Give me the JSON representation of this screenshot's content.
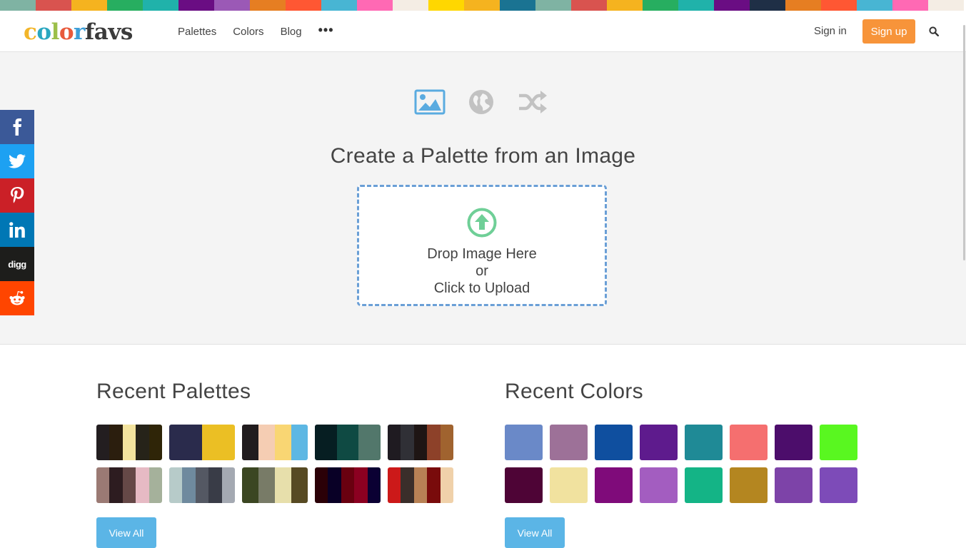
{
  "top_strip_colors": [
    "#7fb3a3",
    "#d9534f",
    "#f5b31f",
    "#27ae60",
    "#20b2aa",
    "#6a0d83",
    "#9b59b6",
    "#e67e22",
    "#ff5733",
    "#48b5d3",
    "#ff69b4",
    "#f4ede4",
    "#ffd700",
    "#f5b31f",
    "#1a7392",
    "#7fb3a3",
    "#d9534f",
    "#f5b31f",
    "#27ae60",
    "#20b2aa",
    "#6a0d83",
    "#1f2f46",
    "#e67e22",
    "#ff5733",
    "#48b5d3",
    "#ff69b4",
    "#f4ede4"
  ],
  "logo": {
    "p1": "c",
    "p2": "o",
    "p3": "l",
    "p4": "o",
    "p5": "r",
    "p6": "favs"
  },
  "nav": {
    "palettes": "Palettes",
    "colors": "Colors",
    "blog": "Blog",
    "more": "•••"
  },
  "auth": {
    "signin": "Sign in",
    "signup": "Sign up"
  },
  "hero": {
    "title": "Create a Palette from an Image",
    "drop_line1": "Drop Image Here",
    "drop_line2": "or",
    "drop_line3": "Click to Upload",
    "icons": [
      "image-icon",
      "globe-icon",
      "shuffle-icon"
    ]
  },
  "social": [
    {
      "name": "facebook",
      "label": "f",
      "color": "#3b5998"
    },
    {
      "name": "twitter",
      "label": "twitter",
      "color": "#1da1f2"
    },
    {
      "name": "pinterest",
      "label": "P",
      "color": "#cb2027"
    },
    {
      "name": "linkedin",
      "label": "in",
      "color": "#0077b5"
    },
    {
      "name": "digg",
      "label": "digg",
      "color": "#1d1d1b"
    },
    {
      "name": "reddit",
      "label": "reddit",
      "color": "#ff4500"
    }
  ],
  "recent_palettes": {
    "title": "Recent Palettes",
    "view_all": "View All",
    "items": [
      [
        "#231e20",
        "#2b1e0e",
        "#f3e39e",
        "#262319",
        "#2f2508"
      ],
      [
        "#2a2b4c",
        "#2a2b4c",
        "#ebbf24",
        "#ebbf24"
      ],
      [
        "#211c1e",
        "#f5cdb3",
        "#f9d673",
        "#5db7e3"
      ],
      [
        "#061e22",
        "#0f4a43",
        "#52776b"
      ],
      [
        "#1f1b21",
        "#303036",
        "#1e1514",
        "#8d4129",
        "#a0632f"
      ],
      [
        "#9b7a74",
        "#2d1c20",
        "#654847",
        "#e6bac4",
        "#a5b19b"
      ],
      [
        "#b7cbc9",
        "#6f8a9e",
        "#545863",
        "#393c47",
        "#a4a9b2"
      ],
      [
        "#3b4622",
        "#787b67",
        "#e7dfab",
        "#574a23"
      ],
      [
        "#2b0007",
        "#090026",
        "#690010",
        "#8b0021",
        "#0b0033"
      ],
      [
        "#cc1919",
        "#3a2e2a",
        "#b88155",
        "#790b0b",
        "#f0d1aa"
      ]
    ]
  },
  "recent_colors": {
    "title": "Recent Colors",
    "view_all": "View All",
    "items": [
      "#6a89c8",
      "#9d7198",
      "#0f4f9f",
      "#5e1b8d",
      "#1f8a96",
      "#f56f6f",
      "#4c0d6b",
      "#59f720",
      "#4e0436",
      "#f1e29f",
      "#7f0b7a",
      "#a35dc0",
      "#14b486",
      "#b48620",
      "#7d43a8",
      "#7d4bb8"
    ]
  }
}
